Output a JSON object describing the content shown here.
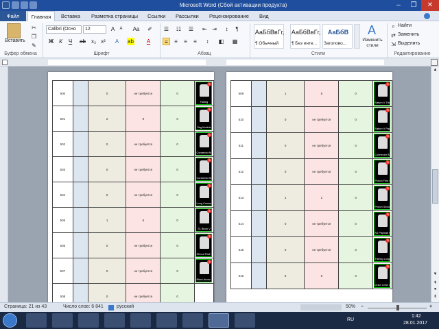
{
  "window": {
    "title": "Microsoft Word (Сбой активации продукта)"
  },
  "tabs": [
    {
      "label": "Файл"
    },
    {
      "label": "Главная"
    },
    {
      "label": "Вставка"
    },
    {
      "label": "Разметка страницы"
    },
    {
      "label": "Ссылки"
    },
    {
      "label": "Рассылки"
    },
    {
      "label": "Рецензирование"
    },
    {
      "label": "Вид"
    }
  ],
  "ribbon": {
    "paste_label": "Вставить",
    "clipboard_label": "Буфер обмена",
    "font_name": "Calibri (Осно",
    "font_size": "12",
    "font_label": "Шрифт",
    "paragraph_label": "Абзац",
    "styles_label": "Стили",
    "edit_label": "Редактирование",
    "styles": [
      {
        "sample": "АаБбВвГг,",
        "name": "¶ Обычный"
      },
      {
        "sample": "АаБбВвГг,",
        "name": "¶ Без инте..."
      },
      {
        "sample": "АаБбВ",
        "name": "Заголово..."
      }
    ],
    "change_styles_label": "Изменить стили",
    "find_label": "Найти",
    "replace_label": "Заменить",
    "select_label": "Выделить",
    "bold": "Ж",
    "italic": "К",
    "underline": "Ч",
    "font_color_glyph": "А"
  },
  "pages": [
    {
      "rows": [
        {
          "id": "500",
          "c": "0",
          "d": "не требуется",
          "e": "0",
          "part": "Fairing",
          "badge": "5"
        },
        {
          "id": "501",
          "c": "2",
          "d": "9",
          "e": "0",
          "part": "Sag Module",
          "badge": "5"
        },
        {
          "id": "502",
          "c": "0",
          "d": "не требуется",
          "e": "0",
          "part": "Connector Medium to Small",
          "badge": "5"
        },
        {
          "id": "503",
          "c": "0",
          "d": "не требуется",
          "e": "0",
          "part": "Connector Medium to Medium",
          "badge": "5"
        },
        {
          "id": "504",
          "c": "0",
          "d": "не требуется",
          "e": "0",
          "part": "Long Connector Medium to Medium",
          "badge": "5"
        },
        {
          "id": "505",
          "c": "1",
          "d": "5",
          "e": "0",
          "part": "S1 Block V",
          "badge": "5"
        },
        {
          "id": "506",
          "c": "0",
          "d": "не требуется",
          "e": "0",
          "part": "Shrout First Stage",
          "badge": "5"
        },
        {
          "id": "507",
          "c": "0",
          "d": "не требуется",
          "e": "0",
          "part": "Black Arrow First Stage",
          "badge": "5"
        },
        {
          "id": "508",
          "c": "0",
          "d": "не требуется",
          "e": "0",
          "part": "",
          "badge": ""
        }
      ]
    },
    {
      "rows": [
        {
          "id": "509",
          "c": "1",
          "d": "5",
          "e": "0",
          "part": "Saturn V Third Stage",
          "badge": "5"
        },
        {
          "id": "510",
          "c": "0",
          "d": "не требуется",
          "e": "0",
          "part": "Saturn V Payload Fairing",
          "badge": "5"
        },
        {
          "id": "511",
          "c": "0",
          "d": "не требуется",
          "e": "0",
          "part": "Connector Black Inter",
          "badge": "5"
        },
        {
          "id": "512",
          "c": "0",
          "d": "не требуется",
          "e": "0",
          "part": "Proton First Stage",
          "badge": "5"
        },
        {
          "id": "513",
          "c": "1",
          "d": "1",
          "e": "0",
          "part": "Proton Second Stage",
          "badge": "5"
        },
        {
          "id": "514",
          "c": "0",
          "d": "не требуется",
          "e": "0",
          "part": "N1 Payload Fairing",
          "badge": "5"
        },
        {
          "id": "515",
          "c": "0",
          "d": "не требуется",
          "e": "0",
          "part": "Fairing Long",
          "badge": "5"
        },
        {
          "id": "516",
          "c": "5",
          "d": "9",
          "e": "0",
          "part": "Orion Crew Capsule",
          "badge": "5"
        }
      ]
    }
  ],
  "status": {
    "page": "Страница: 21 из 43",
    "words": "Число слов: 6 841",
    "lang": "русский",
    "zoom": "50%"
  },
  "taskbar": {
    "lang": "RU",
    "time": "1:42",
    "date": "28.01.2017"
  }
}
